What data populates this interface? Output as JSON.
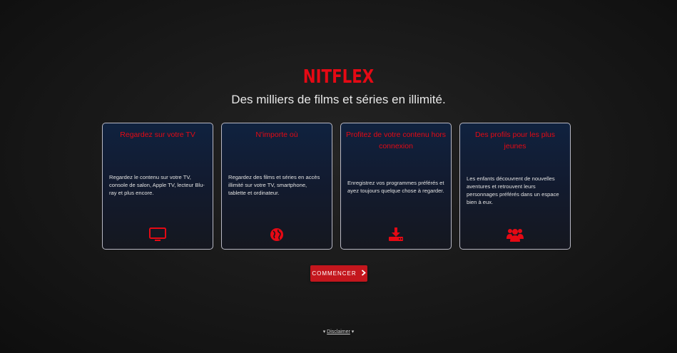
{
  "brand": {
    "logo": "NITFLEX",
    "color": "#e50914"
  },
  "tagline": "Des milliers de films et séries en illimité.",
  "features": [
    {
      "title": "Regardez sur votre TV",
      "text": "Regardez le contenu sur votre TV, console de salon, Apple TV, lecteur Blu-ray et plus encore.",
      "icon": "tv-icon"
    },
    {
      "title": "N'importe où",
      "text": "Regardez des films et séries en accès illimité sur votre TV, smartphone, tablette et ordinateur.",
      "icon": "globe-icon"
    },
    {
      "title": "Profitez de votre contenu hors connexion",
      "text": "Enregistrez vos programmes préférés et ayez toujours quelque chose à regarder.",
      "icon": "download-icon"
    },
    {
      "title": "Des profils pour les plus jeunes",
      "text": "Les enfants découvrent de nouvelles aventures et retrouvent leurs personnages préférés dans un espace bien à eux.",
      "icon": "users-icon"
    }
  ],
  "cta": {
    "label": "COMMENCER",
    "icon": "chevron-right-icon"
  },
  "disclaimer": {
    "label": "Disclaimer"
  }
}
